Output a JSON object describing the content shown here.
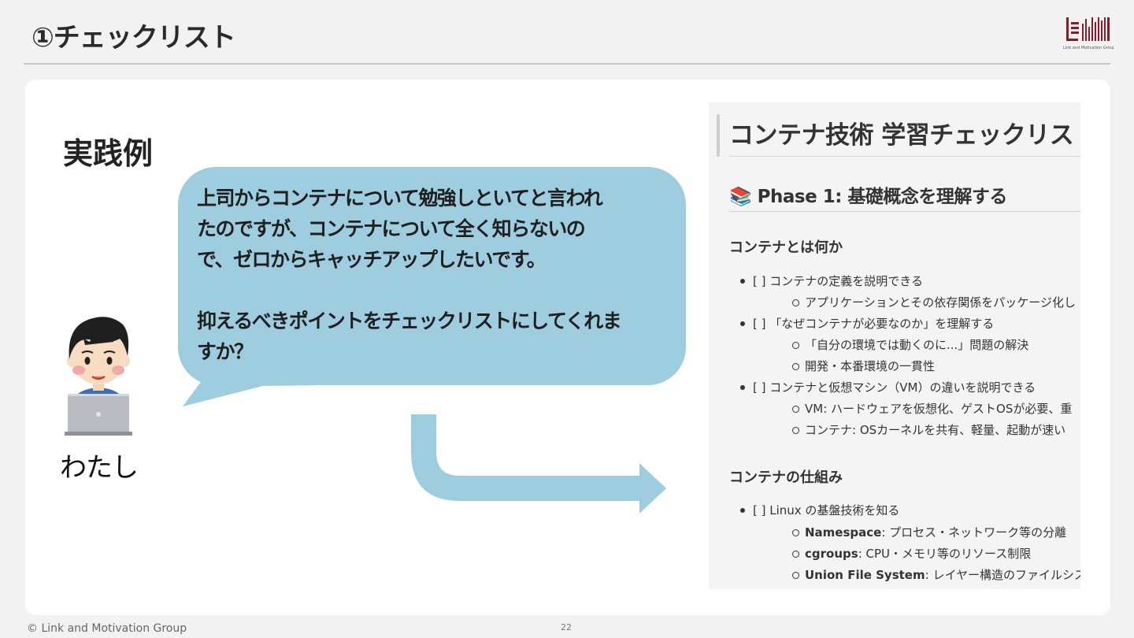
{
  "slide": {
    "title": "①チェックリスト",
    "logo_text": "Link and Motivation Group"
  },
  "left": {
    "heading": "実践例",
    "bubble_lines": [
      "上司からコンテナについて勉強しといてと言われ",
      "たのですが、コンテナについて全く知らないの",
      "で、ゼロからキャッチアップしたいです。",
      "",
      "抑えるべきポイントをチェックリストにしてくれま",
      "すか？"
    ],
    "person_label": "わたし"
  },
  "doc": {
    "h1": "コンテナ技術 学習チェックリスト",
    "h2": "📚 Phase 1: 基礎概念を理解する",
    "sections": [
      {
        "heading": "コンテナとは何か",
        "items": [
          {
            "text": "[ ] コンテナの定義を説明できる",
            "sub": [
              {
                "text": "アプリケーションとその依存関係をパッケージ化し"
              }
            ]
          },
          {
            "text": "[ ] 「なぜコンテナが必要なのか」を理解する",
            "sub": [
              {
                "text": "「自分の環境では動くのに...」問題の解決"
              },
              {
                "text": "開発・本番環境の一貫性"
              }
            ]
          },
          {
            "text": "[ ] コンテナと仮想マシン（VM）の違いを説明できる",
            "sub": [
              {
                "text": "VM: ハードウェアを仮想化、ゲストOSが必要、重"
              },
              {
                "text": "コンテナ: OSカーネルを共有、軽量、起動が速い"
              }
            ]
          }
        ]
      },
      {
        "heading": "コンテナの仕組み",
        "items": [
          {
            "text": "[ ] Linux の基盤技術を知る",
            "sub": [
              {
                "bold": "Namespace",
                "text": ": プロセス・ネットワーク等の分離"
              },
              {
                "bold": "cgroups",
                "text": ": CPU・メモリ等のリソース制限"
              },
              {
                "bold": "Union File System",
                "text": ": レイヤー構造のファイルシス"
              }
            ]
          }
        ]
      }
    ]
  },
  "footer": {
    "copyright": "© Link and Motivation Group",
    "page": "22"
  },
  "colors": {
    "bubble": "#9fcde0",
    "arrow": "#9fcde0",
    "logo": "#8b1a2b"
  }
}
